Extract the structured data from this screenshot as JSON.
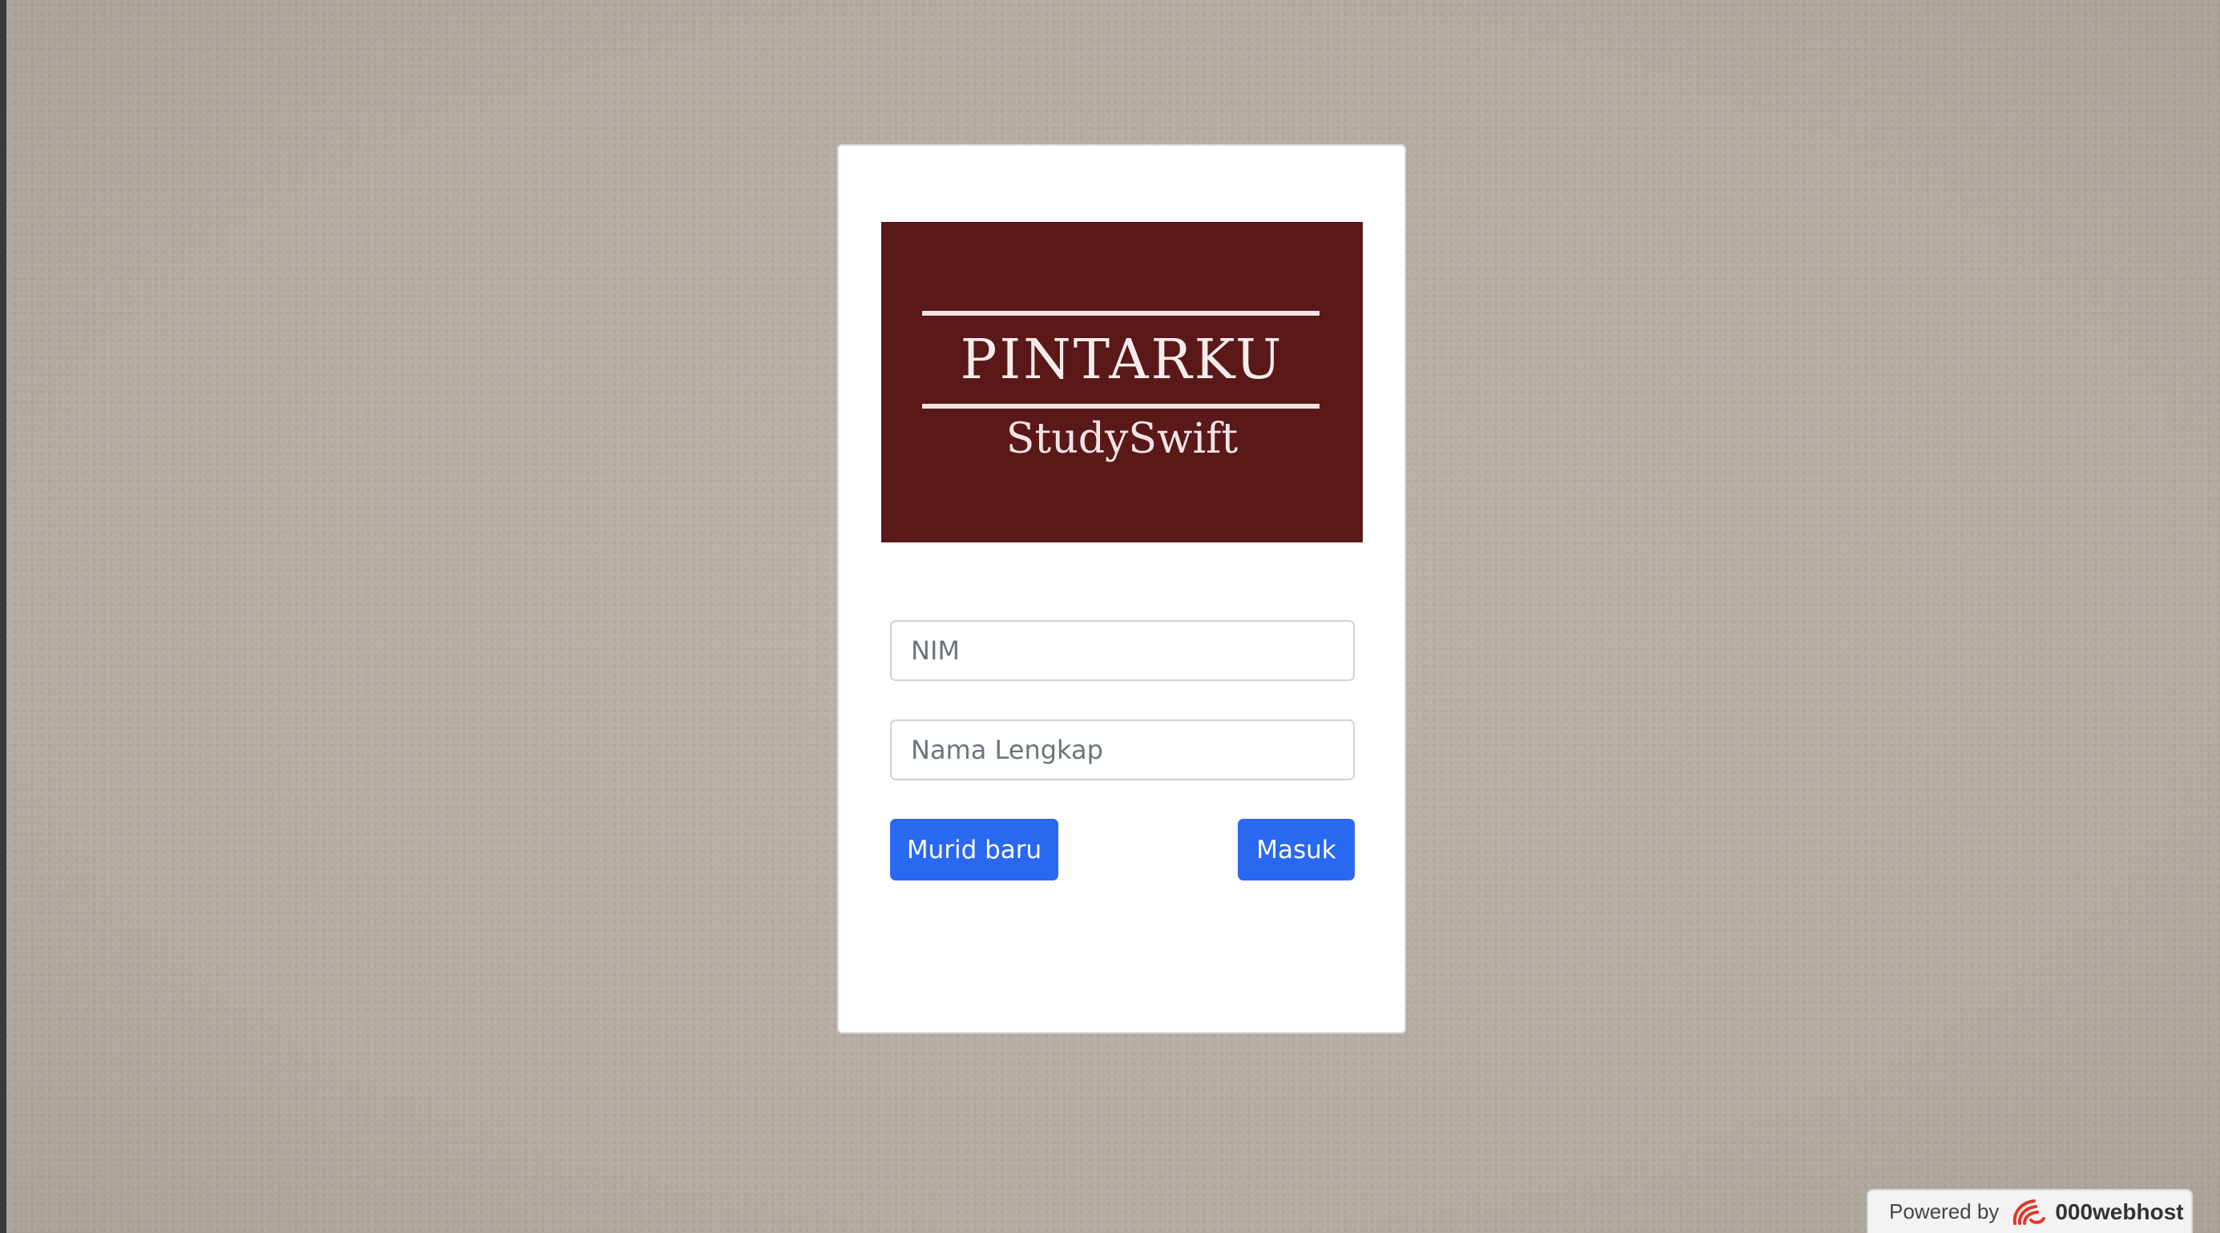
{
  "logo": {
    "title": "PINTARKU",
    "subtitle": "StudySwift",
    "background_color": "#5a1818"
  },
  "form": {
    "nim_placeholder": "NIM",
    "nim_value": "",
    "nama_placeholder": "Nama Lengkap",
    "nama_value": "",
    "new_student_label": "Murid baru",
    "login_label": "Masuk",
    "button_color": "#2968f0"
  },
  "footer": {
    "powered_label": "Powered by",
    "brand": "000webhost",
    "brand_icon": "000webhost-logo-icon"
  }
}
